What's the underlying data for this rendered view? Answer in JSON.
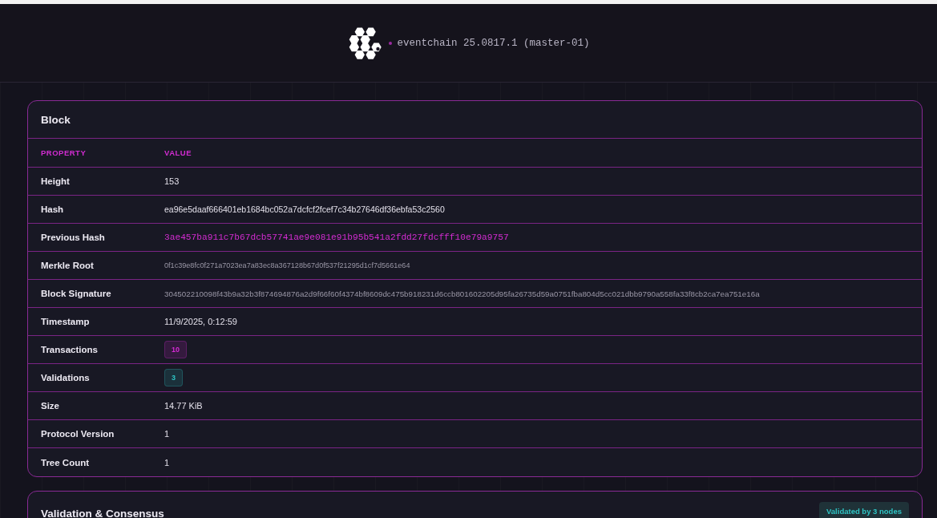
{
  "header": {
    "title": "eventchain 25.0817.1 (master-01)"
  },
  "block": {
    "title": "Block",
    "columns": [
      "PROPERTY",
      "VALUE"
    ],
    "rows": [
      {
        "property": "Height",
        "value": "153",
        "kind": "text"
      },
      {
        "property": "Hash",
        "value": "ea96e5daaf666401eb1684bc052a7dcfcf2fcef7c34b27646df36ebfa53c2560",
        "kind": "hash"
      },
      {
        "property": "Previous Hash",
        "value": "3ae457ba911c7b67dcb57741ae9e081e91b95b541a2fdd27fdcfff10e79a9757",
        "kind": "link"
      },
      {
        "property": "Merkle Root",
        "value": "0f1c39e8fc0f271a7023ea7a83ec8a367128b67d0f537f21295d1cf7d5661e64",
        "kind": "small"
      },
      {
        "property": "Block Signature",
        "value": "304502210098f43b9a32b3f874694876a2d9f66f60f4374bf8609dc475b918231d6ccb801602205d95fa26735d59a0751fba804d5cc021dbb9790a558fa33f8cb2ca7ea751e16a",
        "kind": "tiny"
      },
      {
        "property": "Timestamp",
        "value": "11/9/2025, 0:12:59",
        "kind": "text"
      },
      {
        "property": "Transactions",
        "value": "10",
        "kind": "badge",
        "color": "#d62ad6"
      },
      {
        "property": "Validations",
        "value": "3",
        "kind": "badge",
        "color": "#2ec4c4"
      },
      {
        "property": "Size",
        "value": "14.77 KiB",
        "kind": "text"
      },
      {
        "property": "Protocol Version",
        "value": "1",
        "kind": "text"
      },
      {
        "property": "Tree Count",
        "value": "1",
        "kind": "text"
      }
    ]
  },
  "consensus": {
    "title": "Validation & Consensus",
    "badge": "Validated by 3 nodes"
  }
}
